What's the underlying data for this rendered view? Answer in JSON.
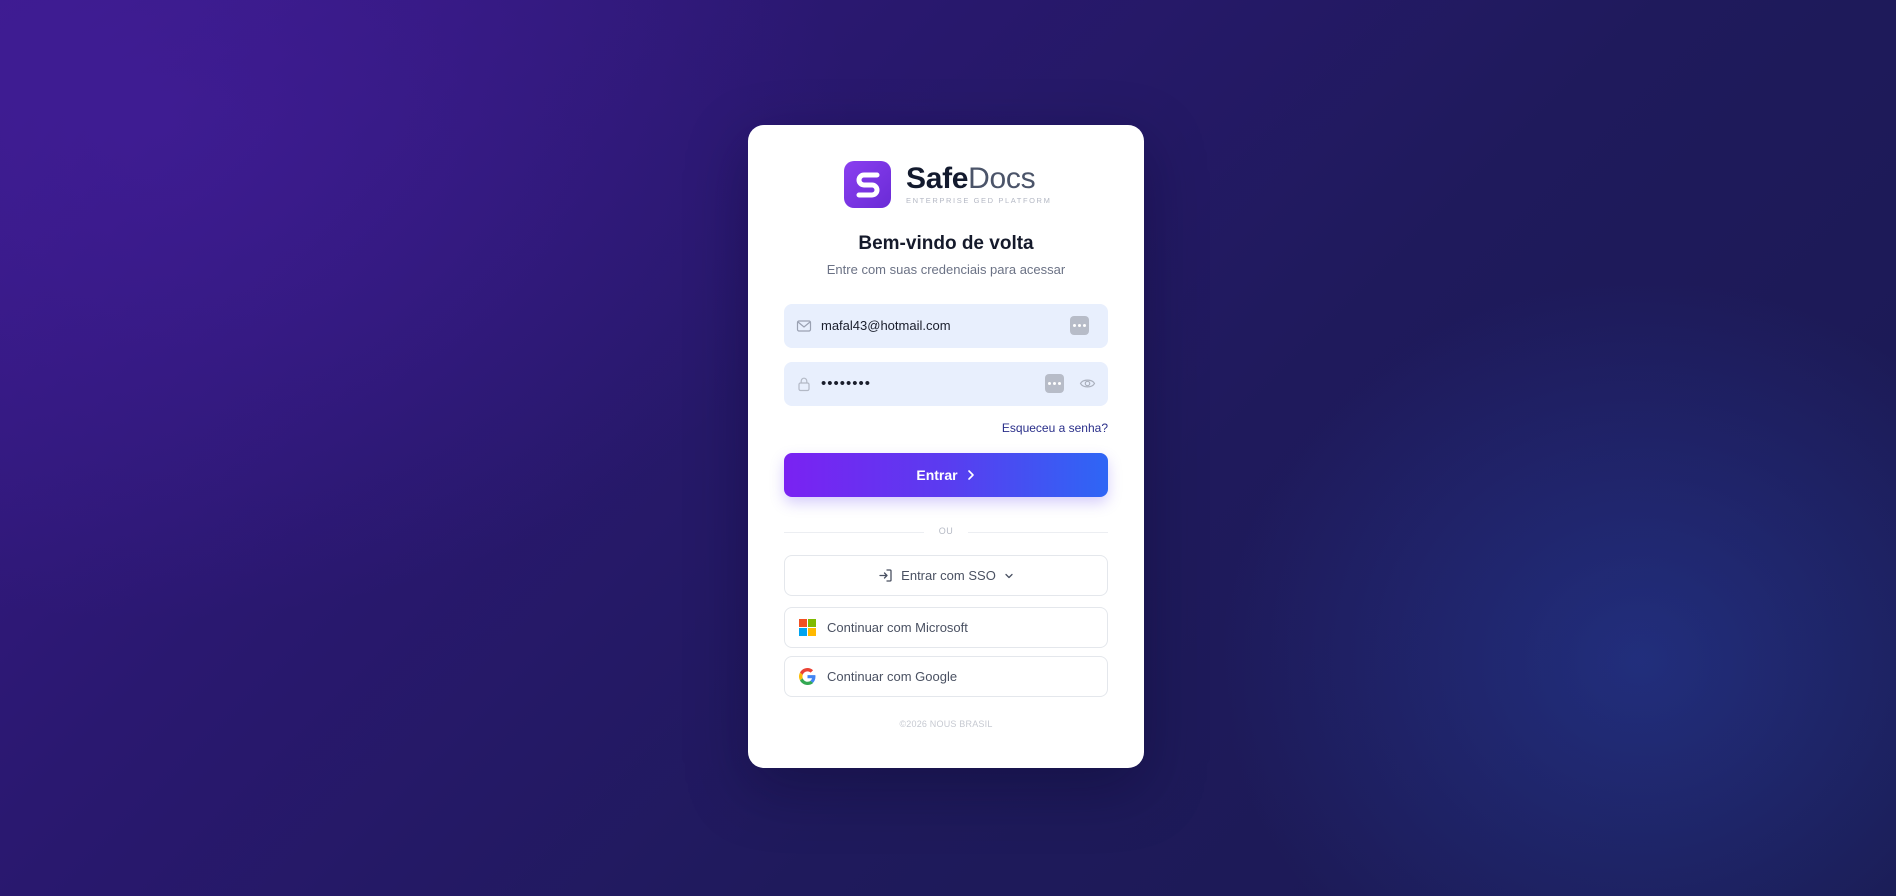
{
  "brand": {
    "name_bold": "Safe",
    "name_light": "Docs",
    "tagline": "ENTERPRISE GED PLATFORM",
    "logo_letter": "S"
  },
  "header": {
    "title": "Bem-vindo de volta",
    "subtitle": "Entre com suas credenciais para acessar"
  },
  "form": {
    "email_value": "mafal43@hotmail.com",
    "email_icon": "mail-icon",
    "password_value": "••••••••",
    "password_icon": "lock-icon",
    "show_password_icon": "eye-icon",
    "forgot_label": "Esqueceu a senha?",
    "submit_label": "Entrar"
  },
  "divider_label": "OU",
  "alternatives": {
    "sso_label": "Entrar com SSO",
    "microsoft_label": "Continuar com Microsoft",
    "google_label": "Continuar com Google"
  },
  "footer": "©2026 NOUS BRASIL",
  "colors": {
    "accent_purple": "#7a22f2",
    "accent_blue": "#2e66f5",
    "field_bg": "#e8effd",
    "bg_dark": "#1f1a5c"
  }
}
